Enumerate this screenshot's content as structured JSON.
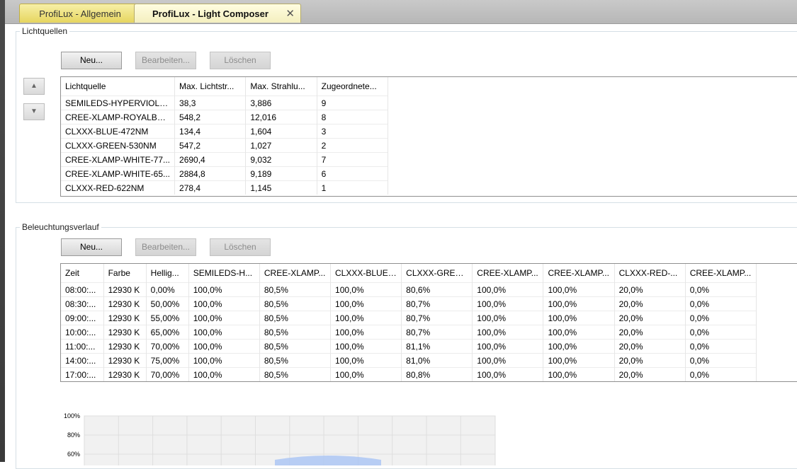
{
  "tabs": [
    {
      "label": "ProfiLux - Allgemein"
    },
    {
      "label": "ProfiLux - Light Composer",
      "close": "✕"
    }
  ],
  "lichtquellen": {
    "title": "Lichtquellen",
    "buttons": {
      "new": "Neu...",
      "edit": "Bearbeiten...",
      "delete": "Löschen"
    },
    "columns": [
      "Lichtquelle",
      "Max. Lichtstr...",
      "Max. Strahlu...",
      "Zugeordnete..."
    ],
    "rows": [
      [
        "SEMILEDS-HYPERVIOLE...",
        "38,3",
        "3,886",
        "9"
      ],
      [
        "CREE-XLAMP-ROYALBLU...",
        "548,2",
        "12,016",
        "8"
      ],
      [
        "CLXXX-BLUE-472NM",
        "134,4",
        "1,604",
        "3"
      ],
      [
        "CLXXX-GREEN-530NM",
        "547,2",
        "1,027",
        "2"
      ],
      [
        "CREE-XLAMP-WHITE-77...",
        "2690,4",
        "9,032",
        "7"
      ],
      [
        "CREE-XLAMP-WHITE-65...",
        "2884,8",
        "9,189",
        "6"
      ],
      [
        "CLXXX-RED-622NM",
        "278,4",
        "1,145",
        "1"
      ]
    ]
  },
  "beleuchtung": {
    "title": "Beleuchtungsverlauf",
    "buttons": {
      "new": "Neu...",
      "edit": "Bearbeiten...",
      "delete": "Löschen"
    },
    "columns": [
      "Zeit",
      "Farbe",
      "Hellig...",
      "SEMILEDS-H...",
      "CREE-XLAMP...",
      "CLXXX-BLUE-...",
      "CLXXX-GREE...",
      "CREE-XLAMP...",
      "CREE-XLAMP...",
      "CLXXX-RED-...",
      "CREE-XLAMP..."
    ],
    "rows": [
      [
        "08:00:...",
        "12930 K",
        "0,00%",
        "100,0%",
        "80,5%",
        "100,0%",
        "80,6%",
        "100,0%",
        "100,0%",
        "20,0%",
        "0,0%"
      ],
      [
        "08:30:...",
        "12930 K",
        "50,00%",
        "100,0%",
        "80,5%",
        "100,0%",
        "80,7%",
        "100,0%",
        "100,0%",
        "20,0%",
        "0,0%"
      ],
      [
        "09:00:...",
        "12930 K",
        "55,00%",
        "100,0%",
        "80,5%",
        "100,0%",
        "80,7%",
        "100,0%",
        "100,0%",
        "20,0%",
        "0,0%"
      ],
      [
        "10:00:...",
        "12930 K",
        "65,00%",
        "100,0%",
        "80,5%",
        "100,0%",
        "80,7%",
        "100,0%",
        "100,0%",
        "20,0%",
        "0,0%"
      ],
      [
        "11:00:...",
        "12930 K",
        "70,00%",
        "100,0%",
        "80,5%",
        "100,0%",
        "81,1%",
        "100,0%",
        "100,0%",
        "20,0%",
        "0,0%"
      ],
      [
        "14:00:...",
        "12930 K",
        "75,00%",
        "100,0%",
        "80,5%",
        "100,0%",
        "81,0%",
        "100,0%",
        "100,0%",
        "20,0%",
        "0,0%"
      ],
      [
        "17:00:...",
        "12930 K",
        "70,00%",
        "100,0%",
        "80,5%",
        "100,0%",
        "80,8%",
        "100,0%",
        "100,0%",
        "20,0%",
        "0,0%"
      ]
    ]
  },
  "chart_data": {
    "type": "area",
    "yticks": [
      "100%",
      "80%",
      "60%"
    ],
    "ylim": [
      60,
      100
    ],
    "grid": true,
    "color": "#a9c4f5"
  },
  "colors": {
    "active_tab": "#f4efbf",
    "inactive_tab": "#e6d55f"
  },
  "icons": {
    "up": "up-arrow-icon",
    "down": "down-arrow-icon"
  }
}
